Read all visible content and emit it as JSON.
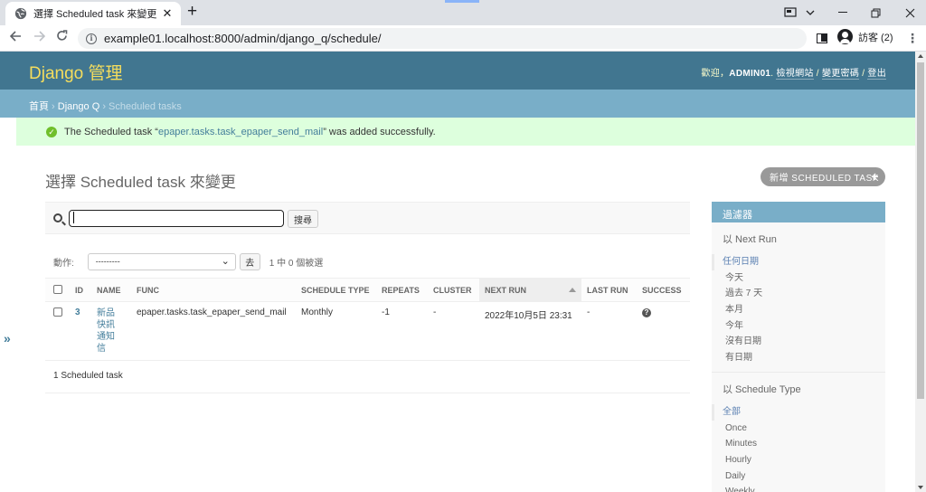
{
  "browser": {
    "tab_title": "選擇 Scheduled task 來變更 | Dj",
    "tab_close": "✕",
    "new_tab": "+",
    "url": "example01.localhost:8000/admin/django_q/schedule/",
    "profile_label": "訪客 (2)",
    "icons": [
      "globe-icon",
      "back-icon",
      "forward-icon",
      "reload-icon",
      "info-icon",
      "side-panel-icon",
      "profile-icon",
      "menu-icon",
      "minimize-icon",
      "maximize-icon",
      "close-icon",
      "tab-search-icon"
    ]
  },
  "header": {
    "brand": "Django 管理",
    "welcome": "歡迎，",
    "username": "ADMIN01",
    "period": ".",
    "view_site": "檢視網站",
    "sep1": " / ",
    "change_password": "變更密碼",
    "sep2": " / ",
    "logout": "登出"
  },
  "breadcrumbs": {
    "home": "首頁",
    "sep1": " › ",
    "app": "Django Q",
    "sep2": " › ",
    "current": "Scheduled tasks"
  },
  "message": {
    "prefix": "The Scheduled task “",
    "link": "epaper.tasks.task_epaper_send_mail",
    "suffix": "” was added successfully."
  },
  "main": {
    "title": "選擇 Scheduled task 來變更",
    "add_button": "新增 SCHEDULED TASK",
    "search_value": "",
    "search_button": "搜尋",
    "action_label": "動作:",
    "action_selected": "---------",
    "go_button": "去",
    "selection_counter": "1 中 0 個被選",
    "paginator": "1 Scheduled task"
  },
  "table": {
    "columns": [
      "ID",
      "NAME",
      "FUNC",
      "SCHEDULE TYPE",
      "REPEATS",
      "CLUSTER",
      "NEXT RUN",
      "LAST RUN",
      "SUCCESS"
    ],
    "rows": [
      {
        "id": "3",
        "name": "新品快訊通知信",
        "func": "epaper.tasks.task_epaper_send_mail",
        "schedule_type": "Monthly",
        "repeats": "-1",
        "cluster": "-",
        "next_run": "2022年10月5日 23:31",
        "last_run": "-",
        "success": "?"
      }
    ]
  },
  "filter": {
    "title": "過濾器",
    "sections": [
      {
        "heading": "以 Next Run",
        "items": [
          "任何日期",
          "今天",
          "過去 7 天",
          "本月",
          "今年",
          "沒有日期",
          "有日期"
        ]
      },
      {
        "heading": "以 Schedule Type",
        "items": [
          "全部",
          "Once",
          "Minutes",
          "Hourly",
          "Daily",
          "Weekly"
        ]
      }
    ]
  },
  "sidebar_toggle": "»",
  "colors": {
    "header": "#417690",
    "brand": "#f5dd5d",
    "breadcrumbs": "#79aec8",
    "success_bg": "#ddffdd",
    "link": "#447e9b"
  }
}
